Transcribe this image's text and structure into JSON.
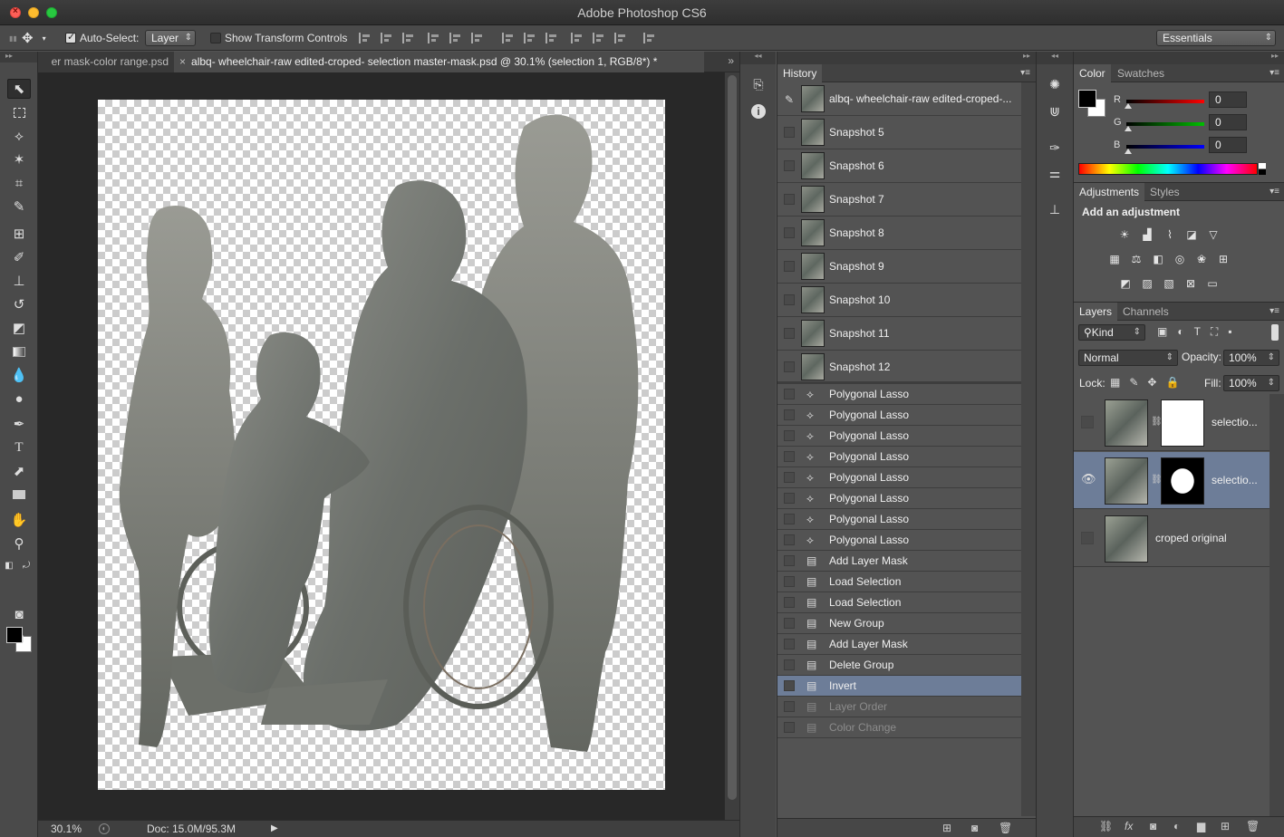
{
  "app": {
    "title": "Adobe Photoshop CS6"
  },
  "options": {
    "auto_select_label": "Auto-Select:",
    "auto_select_checked": true,
    "auto_select_value": "Layer",
    "show_transform_label": "Show Transform Controls",
    "show_transform_checked": false,
    "workspace": "Essentials"
  },
  "tabs": [
    {
      "label": "er mask-color range.psd",
      "active": false
    },
    {
      "label": "albq- wheelchair-raw edited-croped- selection master-mask.psd @ 30.1% (selection 1, RGB/8*) *",
      "active": true
    }
  ],
  "tab_overflow": "»",
  "status": {
    "zoom": "30.1%",
    "doc": "Doc: 15.0M/95.3M"
  },
  "history": {
    "tab_label": "History",
    "source": "albq- wheelchair-raw edited-croped-...",
    "snapshots": [
      "Snapshot 5",
      "Snapshot 6",
      "Snapshot 7",
      "Snapshot 8",
      "Snapshot 9",
      "Snapshot 10",
      "Snapshot 11",
      "Snapshot 12"
    ],
    "states": [
      {
        "label": "Polygonal Lasso",
        "icon": "lasso-icon"
      },
      {
        "label": "Polygonal Lasso",
        "icon": "lasso-icon"
      },
      {
        "label": "Polygonal Lasso",
        "icon": "lasso-icon"
      },
      {
        "label": "Polygonal Lasso",
        "icon": "lasso-icon"
      },
      {
        "label": "Polygonal Lasso",
        "icon": "lasso-icon"
      },
      {
        "label": "Polygonal Lasso",
        "icon": "lasso-icon"
      },
      {
        "label": "Polygonal Lasso",
        "icon": "lasso-icon"
      },
      {
        "label": "Polygonal Lasso",
        "icon": "lasso-icon"
      },
      {
        "label": "Add Layer Mask",
        "icon": "document-icon"
      },
      {
        "label": "Load Selection",
        "icon": "document-icon"
      },
      {
        "label": "Load Selection",
        "icon": "document-icon"
      },
      {
        "label": "New Group",
        "icon": "document-icon"
      },
      {
        "label": "Add Layer Mask",
        "icon": "document-icon"
      },
      {
        "label": "Delete Group",
        "icon": "document-icon"
      },
      {
        "label": "Invert",
        "icon": "document-icon",
        "selected": true
      },
      {
        "label": "Layer Order",
        "icon": "document-icon",
        "dim": true
      },
      {
        "label": "Color Change",
        "icon": "document-icon",
        "dim": true
      }
    ]
  },
  "color_panel": {
    "tabs": [
      "Color",
      "Swatches"
    ],
    "r_label": "R",
    "g_label": "G",
    "b_label": "B",
    "r": "0",
    "g": "0",
    "b": "0"
  },
  "adjustments": {
    "tabs": [
      "Adjustments",
      "Styles"
    ],
    "title": "Add an adjustment"
  },
  "layers": {
    "tabs": [
      "Layers",
      "Channels"
    ],
    "kind": "Kind",
    "blend_mode": "Normal",
    "opacity_label": "Opacity:",
    "opacity": "100%",
    "lock_label": "Lock:",
    "fill_label": "Fill:",
    "fill": "100%",
    "items": [
      {
        "name": "selectio...",
        "visible": false,
        "has_mask": true,
        "selected": false
      },
      {
        "name": "selectio...",
        "visible": true,
        "has_mask": true,
        "selected": true
      },
      {
        "name": "croped original",
        "visible": false,
        "has_mask": false,
        "selected": false
      }
    ]
  },
  "colors": {
    "selection": "#6d7d98",
    "panel": "#535353",
    "canvas_bg": "#282828"
  }
}
